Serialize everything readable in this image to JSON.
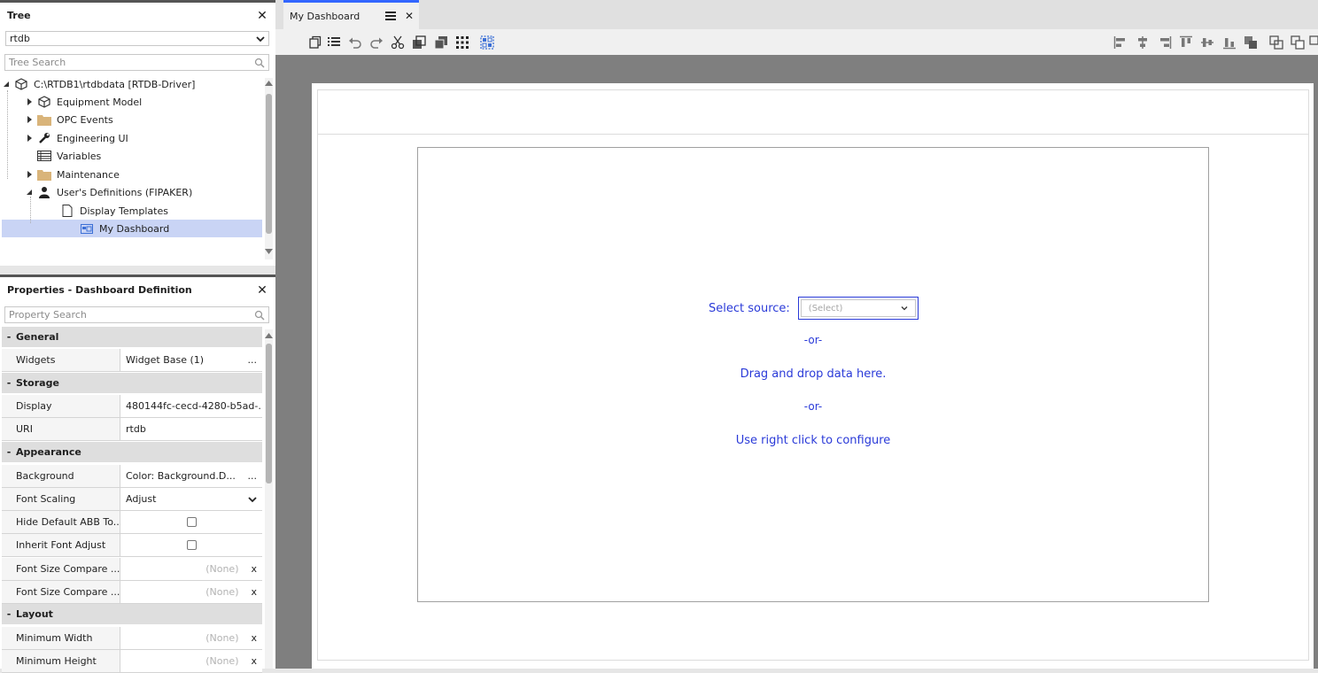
{
  "tree_panel": {
    "title": "Tree",
    "dropdown_value": "rtdb",
    "search_placeholder": "Tree Search",
    "items": [
      {
        "label": "C:\\RTDB1\\rtdbdata [RTDB-Driver]"
      },
      {
        "label": "Equipment Model"
      },
      {
        "label": "OPC Events"
      },
      {
        "label": "Engineering UI"
      },
      {
        "label": "Variables"
      },
      {
        "label": "Maintenance"
      },
      {
        "label": "User's Definitions (FIPAKER)"
      },
      {
        "label": "Display Templates"
      },
      {
        "label": "My Dashboard"
      }
    ]
  },
  "properties_panel": {
    "title": "Properties - Dashboard Definition",
    "search_placeholder": "Property Search",
    "sections": {
      "general": "General",
      "storage": "Storage",
      "appearance": "Appearance",
      "layout": "Layout"
    },
    "rows": {
      "widgets": {
        "name": "Widgets",
        "value": "Widget Base (1)",
        "more": "..."
      },
      "display": {
        "name": "Display",
        "value": "480144fc-cecd-4280-b5ad-..."
      },
      "uri": {
        "name": "URI",
        "value": "rtdb"
      },
      "background": {
        "name": "Background",
        "value": "Color: Background.D...",
        "more": "..."
      },
      "font_scaling": {
        "name": "Font Scaling",
        "value": "Adjust"
      },
      "hide_default": {
        "name": "Hide Default ABB To..."
      },
      "inherit_font": {
        "name": "Inherit Font Adjust"
      },
      "font_size_compare_1": {
        "name": "Font Size Compare ...",
        "value": "(None)",
        "clear": "x"
      },
      "font_size_compare_2": {
        "name": "Font Size Compare ...",
        "value": "(None)",
        "clear": "x"
      },
      "min_width": {
        "name": "Minimum Width",
        "value": "(None)",
        "clear": "x"
      },
      "min_height": {
        "name": "Minimum Height",
        "value": "(None)",
        "clear": "x"
      }
    }
  },
  "document_tab": {
    "label": "My Dashboard",
    "close": "✕"
  },
  "widget": {
    "select_source_label": "Select source:",
    "select_placeholder": "(Select)",
    "or_1": "-or-",
    "drag_drop": "Drag and drop data here.",
    "or_2": "-or-",
    "right_click": "Use right click to configure"
  },
  "colors": {
    "accent": "#3366ff",
    "widget_text": "#2a3ad8",
    "selected_row": "#c9d4f5",
    "canvas": "#7f7f7f"
  }
}
